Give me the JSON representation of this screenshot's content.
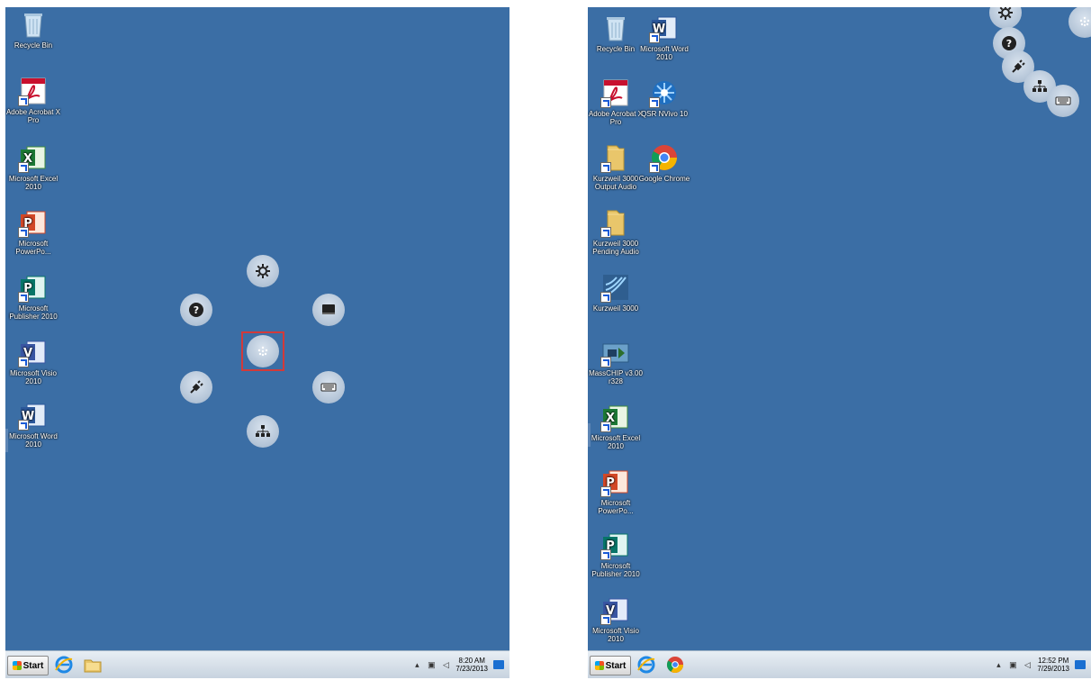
{
  "left_screen": {
    "icons": [
      {
        "label": "Recycle Bin",
        "icon": "recycle-bin-icon"
      },
      {
        "label": "Adobe Acrobat X Pro",
        "icon": "adobe-acrobat-icon"
      },
      {
        "label": "Microsoft Excel 2010",
        "icon": "excel-icon"
      },
      {
        "label": "Microsoft PowerPo...",
        "icon": "powerpoint-icon"
      },
      {
        "label": "Microsoft Publisher 2010",
        "icon": "publisher-icon"
      },
      {
        "label": "Microsoft Visio 2010",
        "icon": "visio-icon"
      },
      {
        "label": "Microsoft Word 2010",
        "icon": "word-icon"
      }
    ],
    "radial_menu": [
      "settings-gear-icon",
      "display-icon",
      "keyboard-icon",
      "network-icon",
      "connect-plug-icon",
      "help-icon",
      "center-dots-icon"
    ],
    "taskbar": {
      "start_label": "Start",
      "time": "8:20 AM",
      "date": "7/23/2013"
    }
  },
  "right_screen": {
    "icons": [
      {
        "label": "Recycle Bin",
        "icon": "recycle-bin-icon"
      },
      {
        "label": "Microsoft Word 2010",
        "icon": "word-icon"
      },
      {
        "label": "Adobe Acrobat X Pro",
        "icon": "adobe-acrobat-icon"
      },
      {
        "label": "QSR NVivo 10",
        "icon": "nvivo-icon"
      },
      {
        "label": "Kurzweil 3000 Output Audio",
        "icon": "folder-icon"
      },
      {
        "label": "Google Chrome",
        "icon": "chrome-icon"
      },
      {
        "label": "Kurzweil 3000 Pending Audio",
        "icon": "folder-icon"
      },
      {
        "label": "Kurzweil 3000",
        "icon": "kurzweil-icon"
      },
      {
        "label": "MassCHIP v3.00 r328",
        "icon": "masschip-icon"
      },
      {
        "label": "Microsoft Excel 2010",
        "icon": "excel-icon"
      },
      {
        "label": "Microsoft PowerPo...",
        "icon": "powerpoint-icon"
      },
      {
        "label": "Microsoft Publisher 2010",
        "icon": "publisher-icon"
      },
      {
        "label": "Microsoft Visio 2010",
        "icon": "visio-icon"
      }
    ],
    "taskbar": {
      "start_label": "Start",
      "time": "12:52 PM",
      "date": "7/29/2013"
    }
  },
  "colors": {
    "desktop": "#3b6ea5",
    "highlight": "#d23a3a"
  }
}
